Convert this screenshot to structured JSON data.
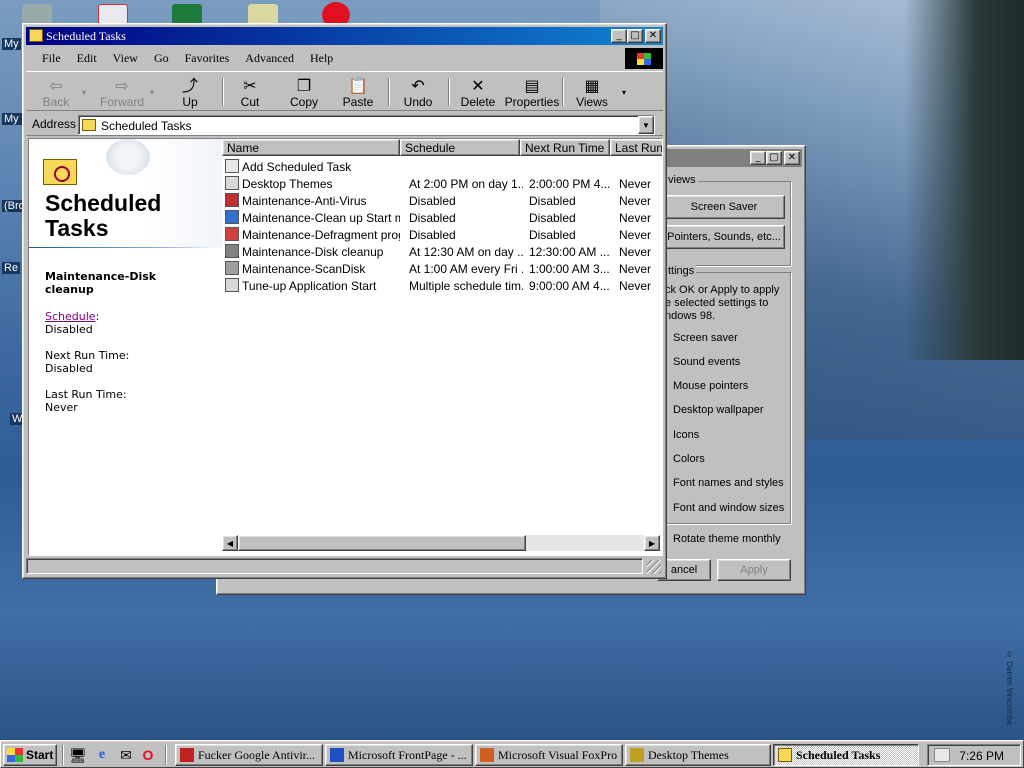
{
  "desktop": {
    "icon_labels": [
      "My",
      "My D",
      "(Bro",
      "Re",
      "W"
    ],
    "copyright": "© Darren Vinicombe"
  },
  "background_dialog": {
    "views_group_label": "views",
    "screen_saver_button": "Screen Saver",
    "pointers_button": "Pointers, Sounds, etc...",
    "settings_group_label": "ttings",
    "instructions": "ck OK or Apply to apply\n e selected settings to\nndows 98.",
    "settings": [
      "Screen saver",
      "Sound events",
      "Mouse pointers",
      "Desktop wallpaper",
      "Icons",
      "Colors",
      "Font names and styles",
      "Font and window sizes"
    ],
    "rotate_theme": "Rotate theme monthly",
    "cancel_button": "ancel",
    "apply_button": "Apply"
  },
  "window": {
    "title": "Scheduled Tasks",
    "menu": [
      "File",
      "Edit",
      "View",
      "Go",
      "Favorites",
      "Advanced",
      "Help"
    ],
    "toolbar": {
      "back": "Back",
      "forward": "Forward",
      "up": "Up",
      "cut": "Cut",
      "copy": "Copy",
      "paste": "Paste",
      "undo": "Undo",
      "delete": "Delete",
      "properties": "Properties",
      "views": "Views"
    },
    "address": {
      "label": "Address",
      "value": "Scheduled Tasks"
    },
    "left_pane": {
      "title": "Scheduled Tasks",
      "selected_item": "Maintenance-Disk cleanup",
      "schedule_link": "Schedule",
      "schedule_colon": ":",
      "schedule_value": "Disabled",
      "next_run_label": "Next Run Time:",
      "next_run_value": "Disabled",
      "last_run_label": "Last Run Time:",
      "last_run_value": "Never"
    },
    "columns": [
      "Name",
      "Schedule",
      "Next Run Time",
      "Last Run"
    ],
    "tasks": [
      {
        "name": "Add Scheduled Task",
        "schedule": "",
        "next": "",
        "last": "",
        "icon": "add-task-icon"
      },
      {
        "name": "Desktop Themes",
        "schedule": "At 2:00 PM on day 1...",
        "next": "2:00:00 PM  4...",
        "last": "Never",
        "icon": "task-icon"
      },
      {
        "name": "Maintenance-Anti-Virus",
        "schedule": "Disabled",
        "next": "Disabled",
        "last": "Never",
        "icon": "antivirus-task-icon"
      },
      {
        "name": "Maintenance-Clean up Start me...",
        "schedule": "Disabled",
        "next": "Disabled",
        "last": "Never",
        "icon": "cleanup-task-icon"
      },
      {
        "name": "Maintenance-Defragment progr...",
        "schedule": "Disabled",
        "next": "Disabled",
        "last": "Never",
        "icon": "defrag-task-icon"
      },
      {
        "name": "Maintenance-Disk cleanup",
        "schedule": "At 12:30 AM on day ...",
        "next": "12:30:00 AM  ...",
        "last": "Never",
        "icon": "disk-cleanup-task-icon"
      },
      {
        "name": "Maintenance-ScanDisk",
        "schedule": "At 1:00 AM every Fri ...",
        "next": "1:00:00 AM  3...",
        "last": "Never",
        "icon": "scandisk-task-icon"
      },
      {
        "name": "Tune-up Application Start",
        "schedule": "Multiple schedule tim...",
        "next": "9:00:00 AM  4...",
        "last": "Never",
        "icon": "task-icon"
      }
    ]
  },
  "taskbar": {
    "start": "Start",
    "buttons": [
      {
        "label": "Fucker Google Antivir...",
        "icon": "fg-icon"
      },
      {
        "label": "Microsoft FrontPage - ...",
        "icon": "frontpage-icon"
      },
      {
        "label": "Microsoft Visual FoxPro",
        "icon": "foxpro-icon"
      },
      {
        "label": "Desktop Themes",
        "icon": "desktop-themes-icon"
      },
      {
        "label": "Scheduled Tasks",
        "icon": "folder-icon"
      }
    ],
    "clock": "7:26 PM"
  },
  "colors": {
    "titlebar_active": "#000080",
    "titlebar_inactive": "#808080",
    "face": "#c0c0c0",
    "link_visited": "#800080"
  }
}
